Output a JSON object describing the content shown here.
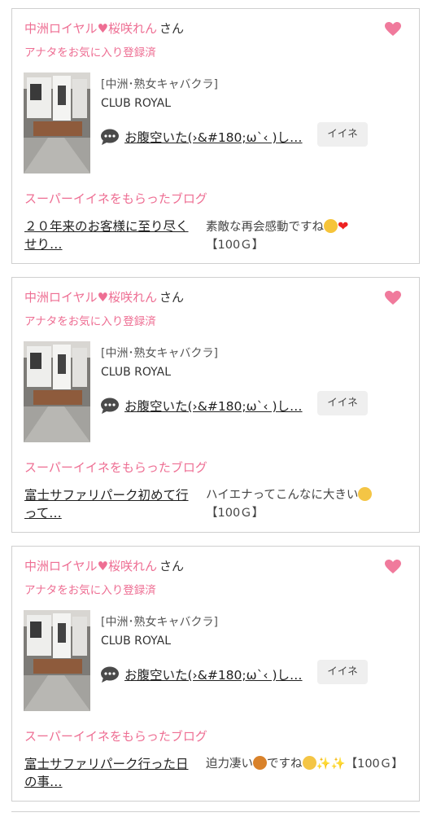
{
  "cards": [
    {
      "shop_heart_title": "中洲ロイヤル",
      "girl_name": "桜咲れん",
      "honorific": "さん",
      "fav_status": "アナタをお気に入り登録済",
      "category": "[中洲･熟女キャバクラ]",
      "shop": "CLUB ROYAL",
      "message": "お腹空いた(›&#180;ω`‹ )し…",
      "iine_label": "イイネ",
      "super_label": "スーパーイイネをもらったブログ",
      "blog_title": "２０年来のお客様に至り尽くせり…",
      "comment_text": "素敵な再会感動ですね",
      "reward": "【100Ｇ】"
    },
    {
      "shop_heart_title": "中洲ロイヤル",
      "girl_name": "桜咲れん",
      "honorific": "さん",
      "fav_status": "アナタをお気に入り登録済",
      "category": "[中洲･熟女キャバクラ]",
      "shop": "CLUB ROYAL",
      "message": "お腹空いた(›&#180;ω`‹ )し…",
      "iine_label": "イイネ",
      "super_label": "スーパーイイネをもらったブログ",
      "blog_title": "富士サファリパーク初めて行って…",
      "comment_text": "ハイエナってこんなに大きい",
      "reward": "【100Ｇ】"
    },
    {
      "shop_heart_title": "中洲ロイヤル",
      "girl_name": "桜咲れん",
      "honorific": "さん",
      "fav_status": "アナタをお気に入り登録済",
      "category": "[中洲･熟女キャバクラ]",
      "shop": "CLUB ROYAL",
      "message": "お腹空いた(›&#180;ω`‹ )し…",
      "iine_label": "イイネ",
      "super_label": "スーパーイイネをもらったブログ",
      "blog_title": "富士サファリパーク行った日の事…",
      "comment_a": "迫力凄い",
      "comment_b": "ですね",
      "reward": "【100Ｇ】"
    }
  ],
  "colors": {
    "accent_pink": "#ee6e93",
    "button_gray": "#efefef",
    "border": "#cfcfcf"
  }
}
